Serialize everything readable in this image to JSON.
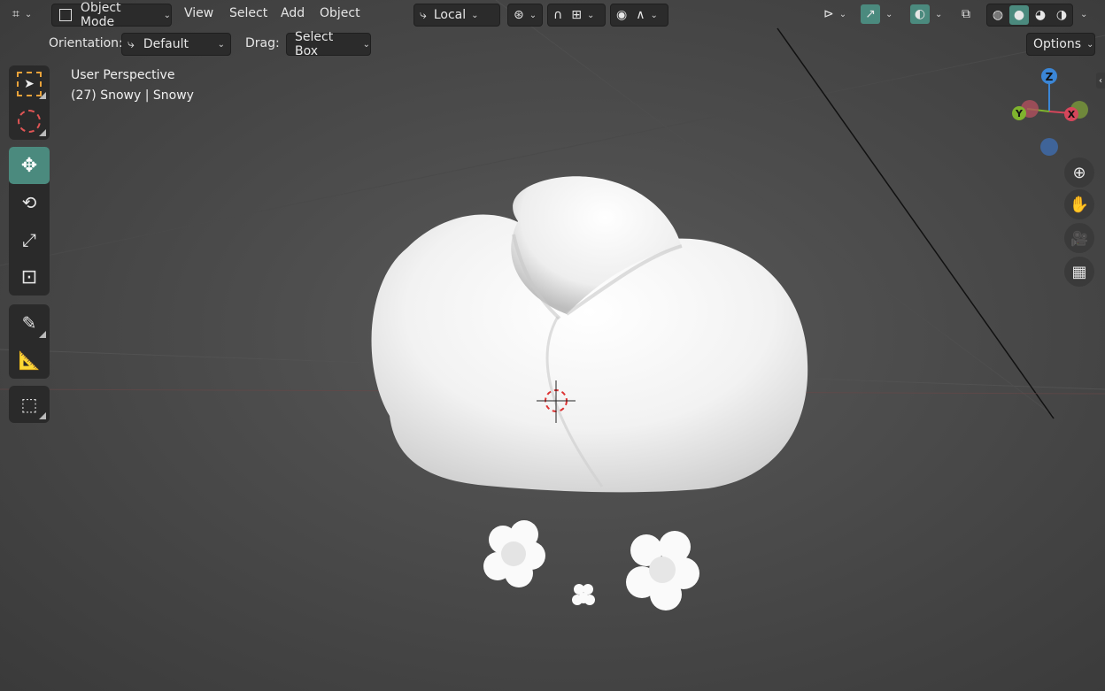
{
  "header": {
    "mode_label": "Object Mode",
    "menus": [
      "View",
      "Select",
      "Add",
      "Object"
    ],
    "pivot_label": "Local",
    "icons": [
      "editor-type-icon",
      "object-mode-icon",
      "transform-orientation-icon",
      "pivot-icon",
      "snap-icon",
      "proportional-icon",
      "visibility-icon",
      "gizmo-icon",
      "overlay-icon",
      "xray-icon",
      "wireframe-shading-icon",
      "solid-shading-icon",
      "material-shading-icon",
      "rendered-shading-icon"
    ]
  },
  "subbar": {
    "orientation_label": "Orientation:",
    "orientation_value": "Default",
    "drag_label": "Drag:",
    "drag_value": "Select Box",
    "options_label": "Options"
  },
  "viewport": {
    "perspective_label": "User Perspective",
    "object_label": "(27) Snowy | Snowy"
  },
  "gizmo": {
    "z_label": "Z",
    "y_label": "Y",
    "x_label": "X",
    "colors": {
      "x": "#d6465b",
      "y": "#7fb32e",
      "z": "#3b86d6"
    }
  },
  "toolbar": {
    "tools": [
      "select-box-tool",
      "cursor-tool",
      "move-tool",
      "rotate-tool",
      "scale-tool",
      "transform-tool",
      "annotate-tool",
      "measure-tool",
      "add-cube-tool"
    ],
    "active_tool": "move-tool",
    "accent": "#4b8a7e"
  }
}
